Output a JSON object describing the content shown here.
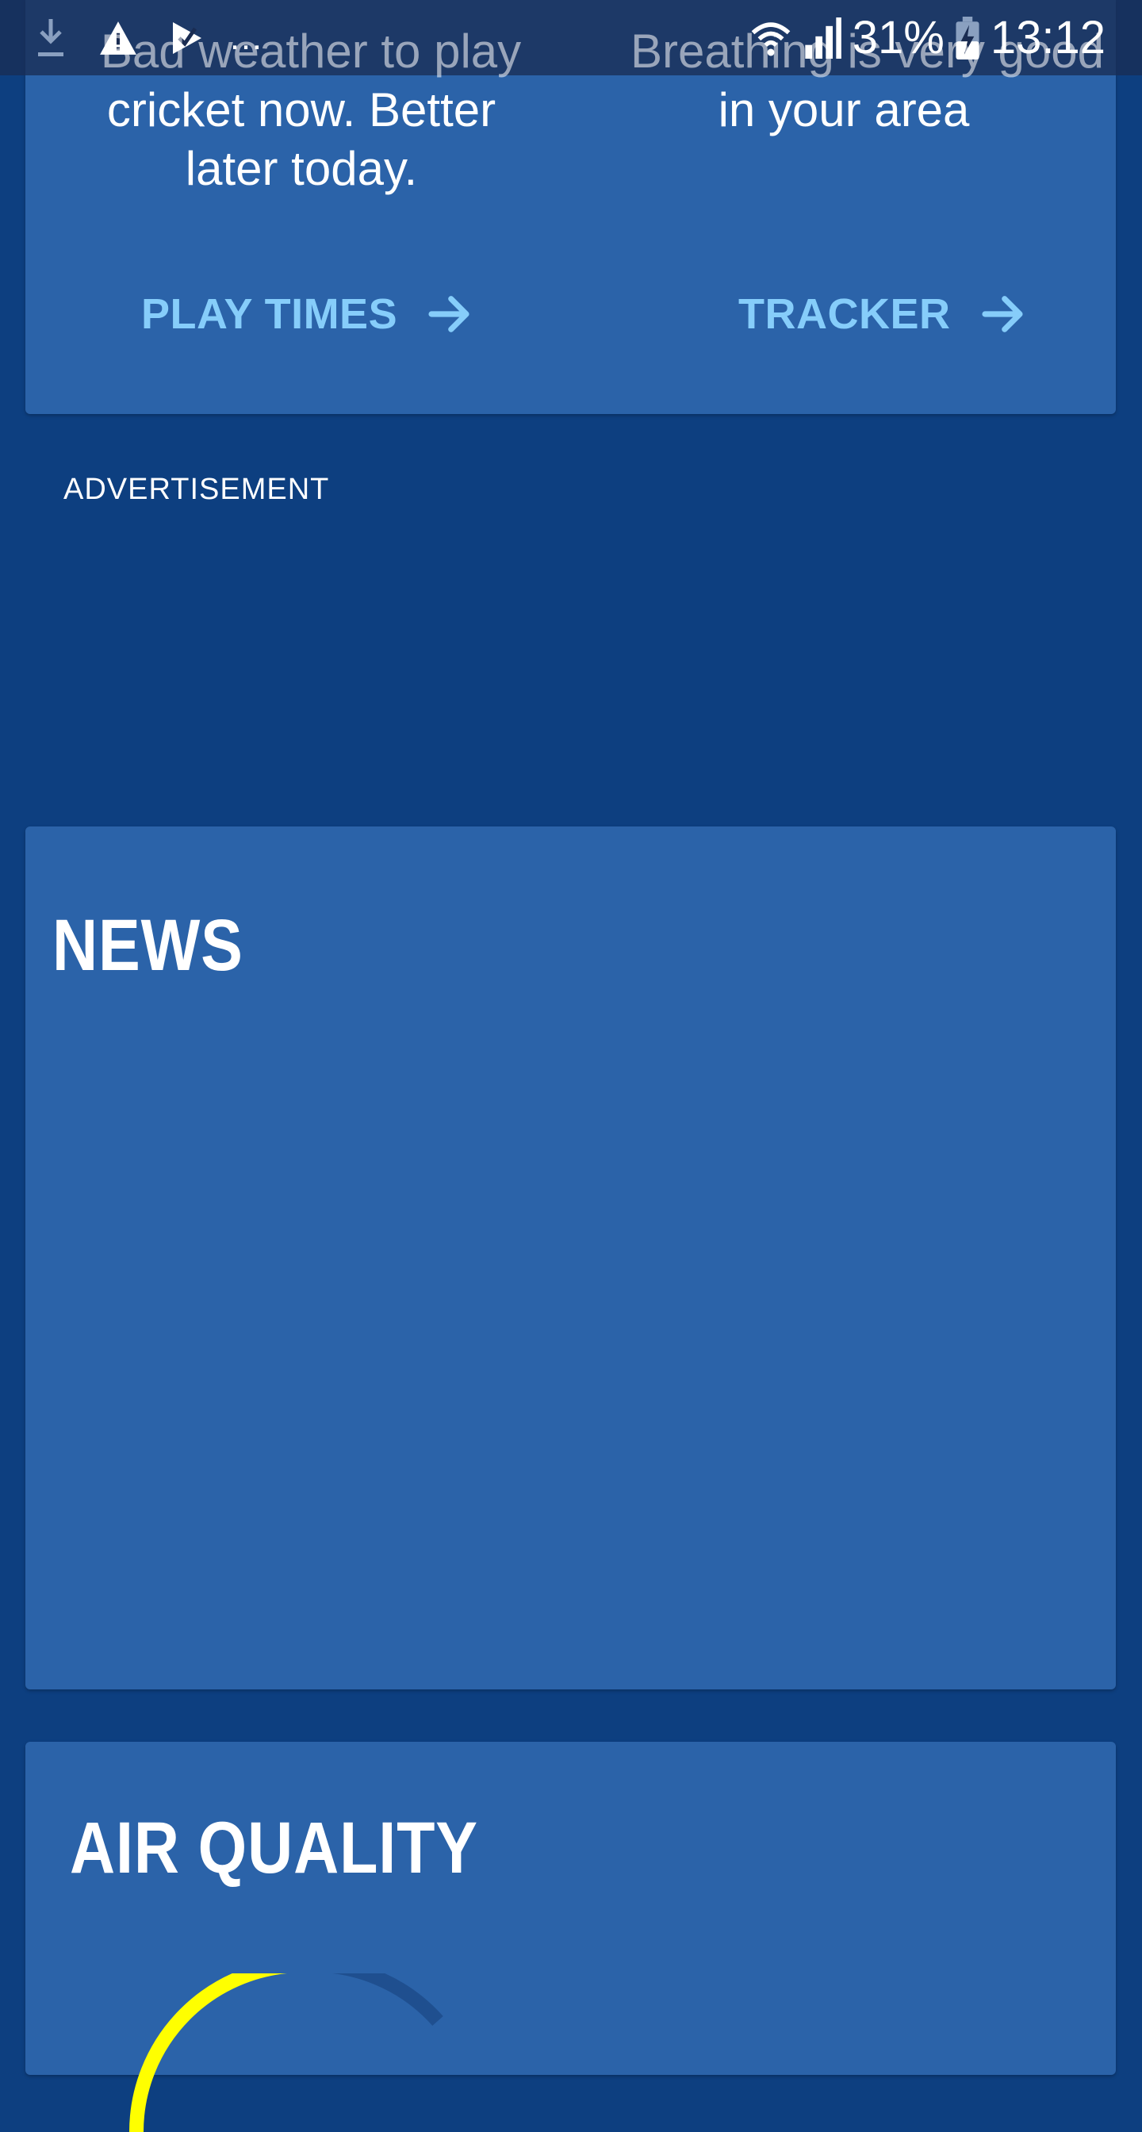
{
  "status_bar": {
    "battery": "31%",
    "time": "13:12",
    "icons": [
      "download-icon",
      "warning-icon",
      "check-icon",
      "more-icon",
      "wifi-icon",
      "signal-icon",
      "battery-charging-icon"
    ],
    "overlay_text_left": "Bad weather to play",
    "overlay_text_right": "Breathing is very good"
  },
  "tips": {
    "cricket": {
      "text_line2": "cricket now. Better",
      "text_line3": "later today.",
      "link_label": "PLAY TIMES"
    },
    "breathing": {
      "text_line2": "in your area",
      "link_label": "TRACKER"
    },
    "link_color": "#86cdfa"
  },
  "advertisement": {
    "label": "ADVERTISEMENT"
  },
  "news": {
    "title": "NEWS"
  },
  "air_quality": {
    "title": "AIR QUALITY",
    "gauge_color": "#ffff00"
  },
  "colors": {
    "background": "#0d3f80",
    "card": "#2b63a9"
  }
}
